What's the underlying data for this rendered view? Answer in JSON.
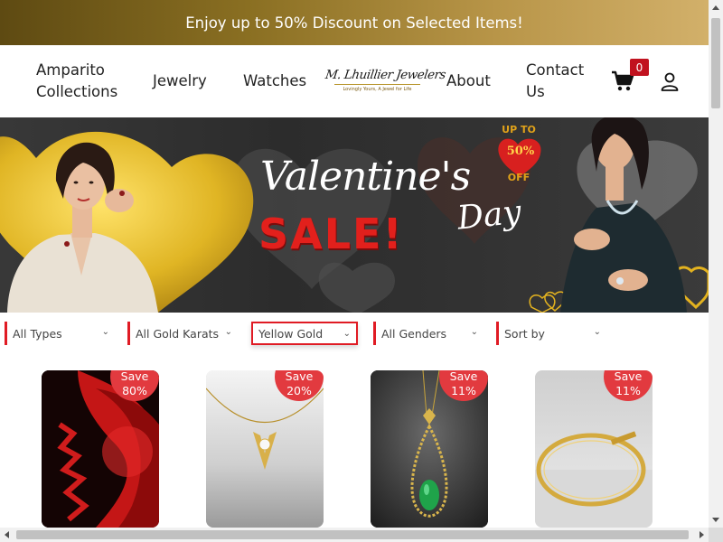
{
  "announcement": "Enjoy up to 50% Discount on Selected Items!",
  "nav": {
    "collections": [
      "Amparito",
      "Collections"
    ],
    "jewelry": "Jewelry",
    "watches": "Watches",
    "logo_script": "M. Lhuillier Jewelers",
    "logo_tagline": "Lovingly Yours, A Jewel for Life",
    "about": "About",
    "contact": [
      "Contact",
      "Us"
    ],
    "cart_count": "0",
    "icons": {
      "cart": "shopping-cart-icon",
      "user": "user-account-icon"
    }
  },
  "hero": {
    "promo_top": "UP TO",
    "promo_pct": "50%",
    "promo_bottom": "OFF",
    "headline_script": "Valentine's",
    "headline_sale": "SALE!",
    "headline_day": "Day",
    "colors": {
      "gold": "#d4a21a",
      "red": "#d8201f",
      "dark": "#333333"
    }
  },
  "filters": [
    {
      "label": "All Types",
      "active": false
    },
    {
      "label": "All Gold Karats",
      "active": false
    },
    {
      "label": "Yellow Gold",
      "active": true
    },
    {
      "label": "All Genders",
      "active": false
    },
    {
      "label": "Sort by",
      "active": false
    }
  ],
  "products": [
    {
      "save_label": "Save",
      "save_pct": "80%",
      "image": "red-abstract-art"
    },
    {
      "save_label": "Save",
      "save_pct": "20%",
      "image": "gold-v-diamond-necklace"
    },
    {
      "save_label": "Save",
      "save_pct": "11%",
      "image": "emerald-teardrop-pendant"
    },
    {
      "save_label": "Save",
      "save_pct": "11%",
      "image": "gold-nail-bangle"
    }
  ],
  "colors": {
    "accent_red": "#e01b24",
    "badge_red": "#e23a3f",
    "cart_badge": "#c1121f"
  }
}
